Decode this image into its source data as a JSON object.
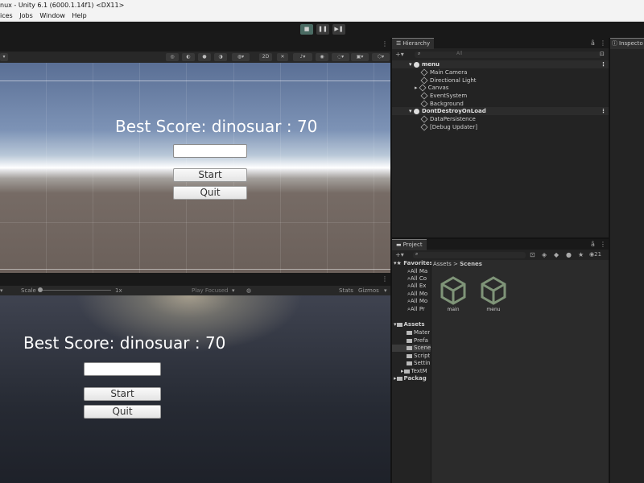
{
  "window": {
    "title": "nux - Unity 6.1 (6000.1.14f1) <DX11>"
  },
  "menu": {
    "items": [
      "ices",
      "Jobs",
      "Window",
      "Help"
    ]
  },
  "toolbar": {
    "play_icon": "stop-icon",
    "pause_icon": "pause-icon",
    "step_icon": "step-icon"
  },
  "scene": {
    "toolbar": {
      "mode_2d": "2D"
    },
    "ui": {
      "score": "Best Score: dinosuar : 70",
      "start": "Start",
      "quit": "Quit"
    }
  },
  "game": {
    "bar": {
      "scale_label": "Scale",
      "scale_value": "1x",
      "play_focused": "Play Focused",
      "stats": "Stats",
      "gizmos": "Gizmos"
    },
    "ui": {
      "score": "Best Score: dinosuar : 70",
      "start": "Start",
      "quit": "Quit"
    }
  },
  "hierarchy": {
    "tab": "Hierarchy",
    "search_placeholder": "All",
    "rows": [
      {
        "label": "menu",
        "type": "scene"
      },
      {
        "label": "Main Camera",
        "type": "object"
      },
      {
        "label": "Directional Light",
        "type": "object"
      },
      {
        "label": "Canvas",
        "type": "object"
      },
      {
        "label": "EventSystem",
        "type": "object"
      },
      {
        "label": "Background",
        "type": "object"
      },
      {
        "label": "DontDestroyOnLoad",
        "type": "scene"
      },
      {
        "label": "DataPersistence",
        "type": "object"
      },
      {
        "label": "[Debug Updater]",
        "type": "object"
      }
    ]
  },
  "inspector": {
    "tab": "Inspecto"
  },
  "project": {
    "tab": "Project",
    "hidden_count": "21",
    "breadcrumb": {
      "root": "Assets",
      "sep": ">",
      "current": "Scenes"
    },
    "favorites": {
      "label": "Favorites",
      "items": [
        "All Ma",
        "All Co",
        "All Ex",
        "All Mo",
        "All Mo",
        "All Pr"
      ]
    },
    "assets": {
      "label": "Assets",
      "items": [
        "Mater",
        "Prefa",
        "Scene",
        "Script",
        "Settin",
        "TextM"
      ]
    },
    "packages": "Packag",
    "files": [
      "main",
      "menu"
    ]
  },
  "colors": {
    "accent": "#4a6b63",
    "logo": "#7f9478",
    "selection": "#3a3a3a"
  }
}
